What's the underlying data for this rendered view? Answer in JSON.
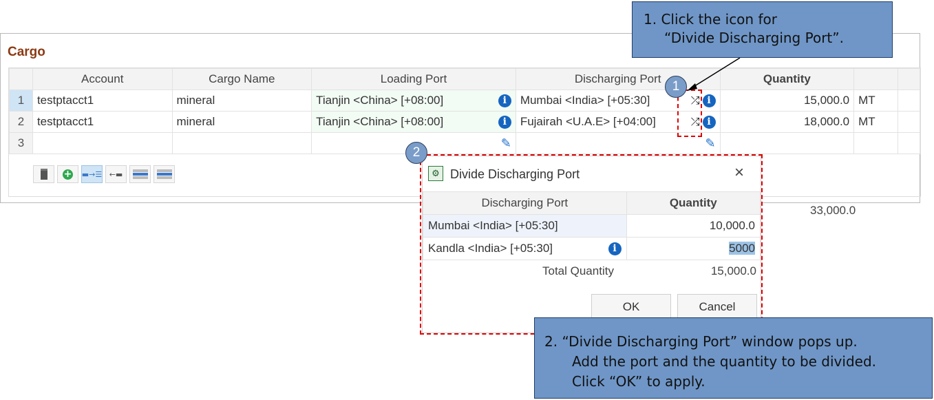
{
  "panel": {
    "title": "Cargo",
    "columns": [
      "",
      "Account",
      "Cargo Name",
      "Loading Port",
      "Discharging Port",
      "Quantity",
      "",
      ""
    ],
    "rows": [
      {
        "num": "1",
        "account": "testptacct1",
        "cargo_name": "mineral",
        "loading_port": "Tianjin <China> [+08:00]",
        "discharging_port": "Mumbai <India> [+05:30]",
        "quantity": "15,000.0",
        "unit": "MT"
      },
      {
        "num": "2",
        "account": "testptacct1",
        "cargo_name": "mineral",
        "loading_port": "Tianjin <China> [+08:00]",
        "discharging_port": "Fujairah <U.A.E> [+04:00]",
        "quantity": "18,000.0",
        "unit": "MT"
      },
      {
        "num": "3",
        "account": "",
        "cargo_name": "",
        "loading_port": "",
        "discharging_port": "",
        "quantity": "",
        "unit": ""
      }
    ],
    "total_quantity": "33,000.0",
    "toolbar": [
      "delete-icon",
      "add-icon",
      "split-icon",
      "merge-icon",
      "insert-above-icon",
      "insert-below-icon"
    ]
  },
  "dialog": {
    "title": "Divide Discharging Port",
    "close_glyph": "×",
    "columns": [
      "Discharging Port",
      "Quantity"
    ],
    "rows": [
      {
        "port": "Mumbai <India> [+05:30]",
        "quantity": "10,000.0"
      },
      {
        "port": "Kandla <India> [+05:30]",
        "quantity": "5000"
      }
    ],
    "total_label": "Total Quantity",
    "total_value": "15,000.0",
    "ok_label": "OK",
    "cancel_label": "Cancel"
  },
  "annotations": {
    "badge1": "1",
    "badge2": "2",
    "callout1_line1": "1.  Click the icon for",
    "callout1_line2": "“Divide Discharging Port”.",
    "callout2_line1": "2. “Divide Discharging Port” window pops up.",
    "callout2_line2": "Add the port and the quantity to be divided.",
    "callout2_line3": "Click “OK” to apply."
  }
}
